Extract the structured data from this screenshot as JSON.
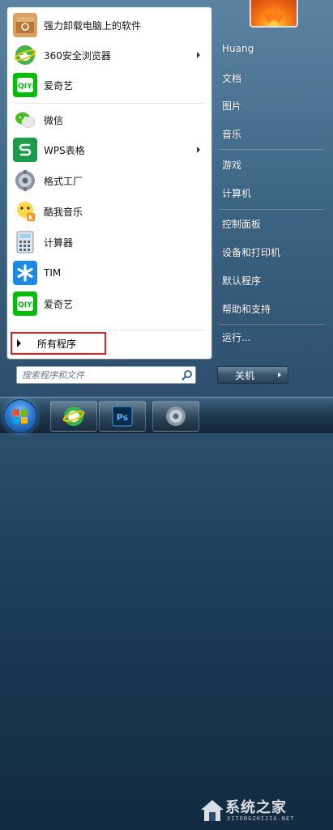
{
  "programs": [
    {
      "label": "强力卸载电脑上的软件",
      "icon": "uninstall-box-icon",
      "submenu": false
    },
    {
      "label": "360安全浏览器",
      "icon": "browser-360-icon",
      "submenu": true
    },
    {
      "label": "爱奇艺",
      "icon": "iqiyi-icon",
      "submenu": false
    },
    {
      "label": "微信",
      "icon": "wechat-icon",
      "submenu": false
    },
    {
      "label": "WPS表格",
      "icon": "wps-sheet-icon",
      "submenu": true
    },
    {
      "label": "格式工厂",
      "icon": "format-factory-icon",
      "submenu": false
    },
    {
      "label": "酷我音乐",
      "icon": "kuwo-music-icon",
      "submenu": false
    },
    {
      "label": "计算器",
      "icon": "calculator-icon",
      "submenu": false
    },
    {
      "label": "TIM",
      "icon": "tim-icon",
      "submenu": false
    },
    {
      "label": "爱奇艺",
      "icon": "iqiyi-icon",
      "submenu": false
    }
  ],
  "all_programs_label": "所有程序",
  "search": {
    "placeholder": "搜索程序和文件"
  },
  "right_items": [
    {
      "label": "Huang"
    },
    {
      "label": "文档"
    },
    {
      "label": "图片"
    },
    {
      "label": "音乐"
    },
    {
      "label": "游戏"
    },
    {
      "label": "计算机"
    },
    {
      "label": "控制面板"
    },
    {
      "label": "设备和打印机"
    },
    {
      "label": "默认程序"
    },
    {
      "label": "帮助和支持"
    },
    {
      "label": "运行..."
    }
  ],
  "shutdown_label": "关机",
  "watermark": {
    "text": "系统之家",
    "sub": "XITONGZHIJIA.NET"
  },
  "colors": {
    "highlight_box": "#e02020",
    "iqiyi_green": "#00be06",
    "wps_green": "#1a9c4a",
    "tim_blue": "#1a8ae6"
  }
}
